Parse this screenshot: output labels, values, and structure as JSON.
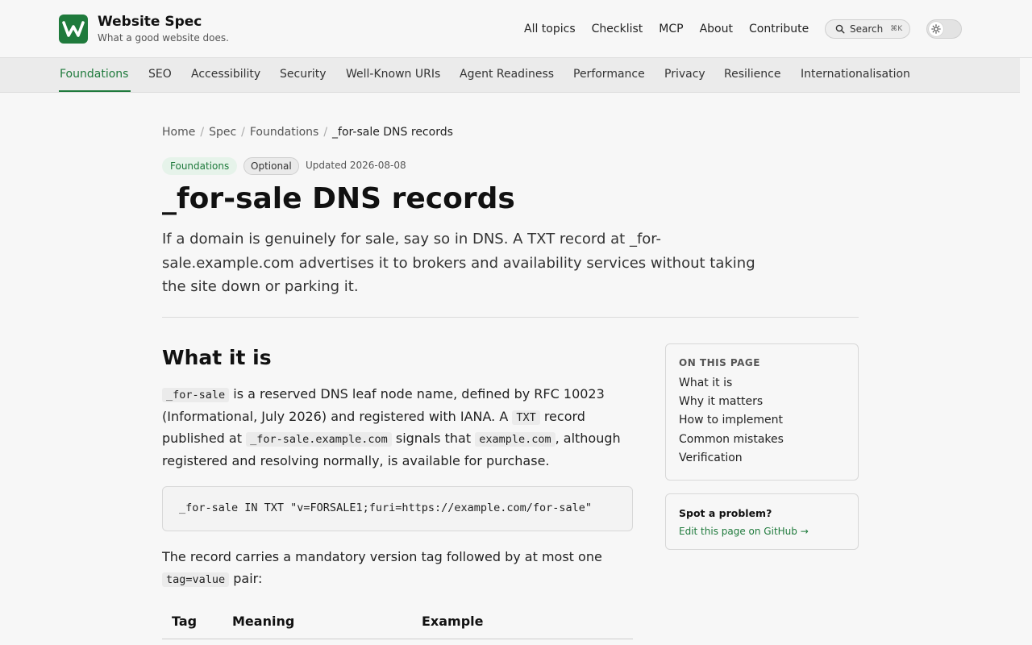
{
  "header": {
    "brand_title": "Website Spec",
    "brand_subtitle": "What a good website does.",
    "logo_letter": "W",
    "nav": [
      "All topics",
      "Checklist",
      "MCP",
      "About",
      "Contribute"
    ],
    "search_label": "Search",
    "search_shortcut": "⌘K"
  },
  "section_nav": {
    "items": [
      "Foundations",
      "SEO",
      "Accessibility",
      "Security",
      "Well-Known URIs",
      "Agent Readiness",
      "Performance",
      "Privacy",
      "Resilience",
      "Internationalisation"
    ],
    "active": "Foundations"
  },
  "breadcrumb": {
    "items": [
      "Home",
      "Spec",
      "Foundations"
    ],
    "current": "_for-sale DNS records"
  },
  "meta": {
    "category_badge": "Foundations",
    "status_badge": "Optional",
    "updated": "Updated 2026-08-08"
  },
  "page": {
    "title": "_for-sale DNS records",
    "lede": "If a domain is genuinely for sale, say so in DNS. A TXT record at _for-sale.example.com advertises it to brokers and availability services without taking the site down or parking it."
  },
  "section": {
    "heading": "What it is",
    "p1_code1": "_for-sale",
    "p1_text1": " is a reserved DNS leaf node name, defined by RFC 10023 (Informational, July 2026) and registered with IANA. A ",
    "p1_code2": "TXT",
    "p1_text2": " record published at ",
    "p1_code3": "_for-sale.example.com",
    "p1_text3": " signals that ",
    "p1_code4": "example.com",
    "p1_text4": ", although registered and resolving normally, is available for purchase.",
    "code_block": "_for-sale IN TXT \"v=FORSALE1;furi=https://example.com/for-sale\"",
    "p2_text1": "The record carries a mandatory version tag followed by at most one ",
    "p2_code1": "tag=value",
    "p2_text2": " pair:",
    "table_headers": [
      "Tag",
      "Meaning",
      "Example"
    ]
  },
  "toc": {
    "title": "ON THIS PAGE",
    "items": [
      "What it is",
      "Why it matters",
      "How to implement",
      "Common mistakes",
      "Verification"
    ]
  },
  "problem": {
    "title": "Spot a problem?",
    "link": "Edit this page on GitHub →"
  },
  "colors": {
    "brand": "#1f7a3c",
    "background": "#f7f7f7"
  }
}
